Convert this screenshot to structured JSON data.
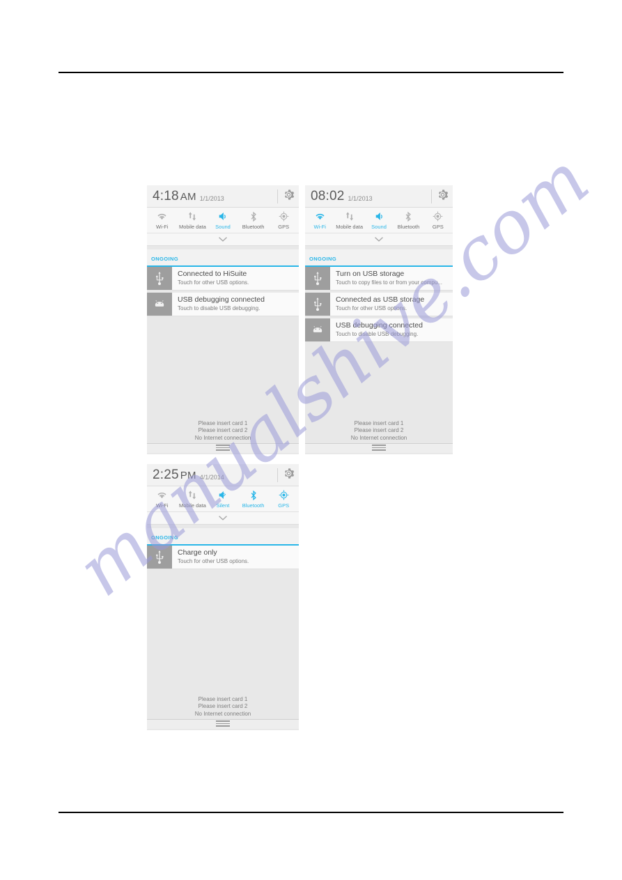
{
  "watermark": {
    "text": "manualshive.com"
  },
  "colors": {
    "accent": "#29b6e8",
    "icon_inactive": "#b0b0b0",
    "icon_active": "#29b6e8",
    "notif_icon_bg": "#9e9e9e",
    "panel_bg": "#e8e8e8"
  },
  "footer": {
    "line1": "Please insert card 1",
    "line2": "Please insert card 2",
    "line3": "No Internet connection"
  },
  "panels": [
    {
      "id": "panel-1",
      "time": "4:18",
      "ampm": "AM",
      "date": "1/1/2013",
      "settings_icon": "gear-icon",
      "toggles": [
        {
          "label": "Wi-Fi",
          "icon": "wifi-icon",
          "active": false
        },
        {
          "label": "Mobile data",
          "icon": "mobile-data-icon",
          "active": false
        },
        {
          "label": "Sound",
          "icon": "sound-icon",
          "active": true
        },
        {
          "label": "Bluetooth",
          "icon": "bluetooth-icon",
          "active": false
        },
        {
          "label": "GPS",
          "icon": "gps-icon",
          "active": false
        }
      ],
      "expander_icon": "chevron-down-icon",
      "section_label": "ONGOING",
      "notifications": [
        {
          "icon": "usb-icon",
          "title": "Connected to HiSuite",
          "subtitle": "Touch for other USB options."
        },
        {
          "icon": "android-icon",
          "title": "USB debugging connected",
          "subtitle": "Touch to disable USB debugging."
        }
      ]
    },
    {
      "id": "panel-2",
      "time": "08:02",
      "ampm": "",
      "date": "1/1/2013",
      "settings_icon": "gear-icon",
      "toggles": [
        {
          "label": "Wi-Fi",
          "icon": "wifi-icon",
          "active": true
        },
        {
          "label": "Mobile data",
          "icon": "mobile-data-icon",
          "active": false
        },
        {
          "label": "Sound",
          "icon": "sound-icon",
          "active": true
        },
        {
          "label": "Bluetooth",
          "icon": "bluetooth-icon",
          "active": false
        },
        {
          "label": "GPS",
          "icon": "gps-icon",
          "active": false
        }
      ],
      "expander_icon": "chevron-down-icon",
      "section_label": "ONGOING",
      "notifications": [
        {
          "icon": "usb-icon",
          "title": "Turn on USB storage",
          "subtitle": "Touch to copy files to or from your compu..."
        },
        {
          "icon": "usb-icon",
          "title": "Connected as USB storage",
          "subtitle": "Touch for other USB options."
        },
        {
          "icon": "android-icon",
          "title": "USB debugging connected",
          "subtitle": "Touch to disable USB debugging."
        }
      ]
    },
    {
      "id": "panel-3",
      "time": "2:25",
      "ampm": "PM",
      "date": "4/1/2014",
      "settings_icon": "gear-icon",
      "toggles": [
        {
          "label": "Wi-Fi",
          "icon": "wifi-icon",
          "active": false
        },
        {
          "label": "Mobile data",
          "icon": "mobile-data-icon",
          "active": false
        },
        {
          "label": "Silent",
          "icon": "silent-icon",
          "active": true
        },
        {
          "label": "Bluetooth",
          "icon": "bluetooth-icon",
          "active": true
        },
        {
          "label": "GPS",
          "icon": "gps-icon",
          "active": true
        }
      ],
      "expander_icon": "chevron-down-icon",
      "section_label": "ONGOING",
      "notifications": [
        {
          "icon": "usb-icon",
          "title": "Charge only",
          "subtitle": "Touch for other USB options."
        }
      ]
    }
  ]
}
